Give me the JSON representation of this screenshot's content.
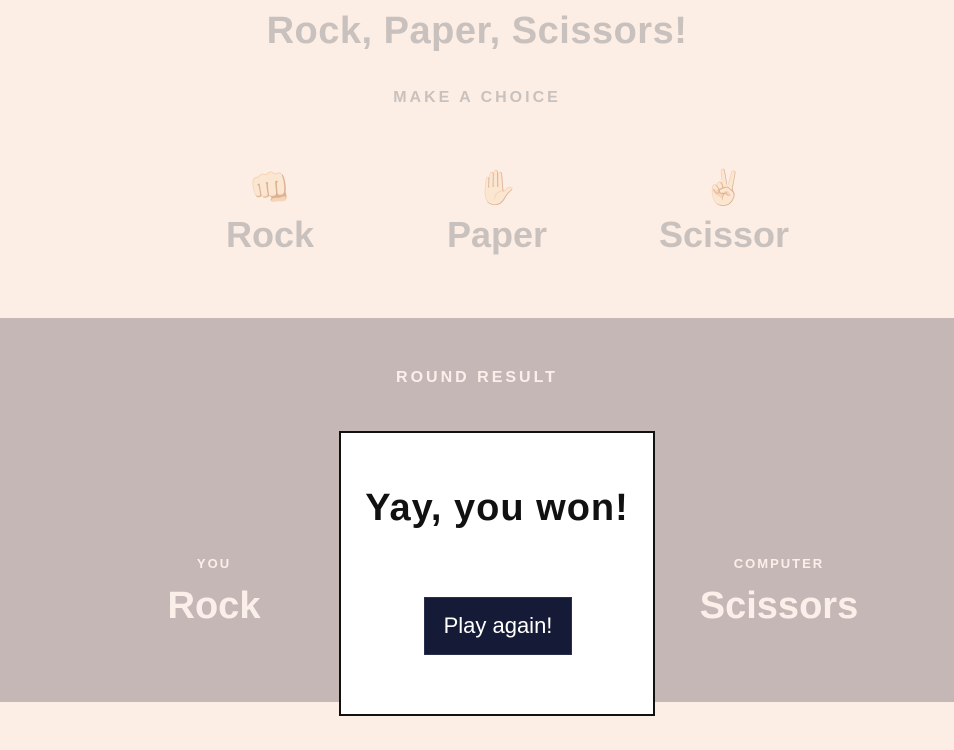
{
  "game": {
    "title": "Rock, Paper, Scissors!",
    "subtitle": "MAKE A CHOICE",
    "choices": [
      {
        "icon": "fist-icon",
        "emoji": "👊🏻",
        "label": "Rock"
      },
      {
        "icon": "raised-hand-icon",
        "emoji": "✋🏻",
        "label": "Paper"
      },
      {
        "icon": "victory-hand-icon",
        "emoji": "✌🏻",
        "label": "Scissor"
      }
    ]
  },
  "result": {
    "heading": "ROUND RESULT",
    "you_label": "YOU",
    "you_pick": "Rock",
    "computer_label": "COMPUTER",
    "computer_pick": "Scissors"
  },
  "modal": {
    "message": "Yay, you won!",
    "button_label": "Play again!"
  },
  "colors": {
    "background": "#fdeee5",
    "result_band": "#c4b7b6",
    "button": "#151a36"
  }
}
